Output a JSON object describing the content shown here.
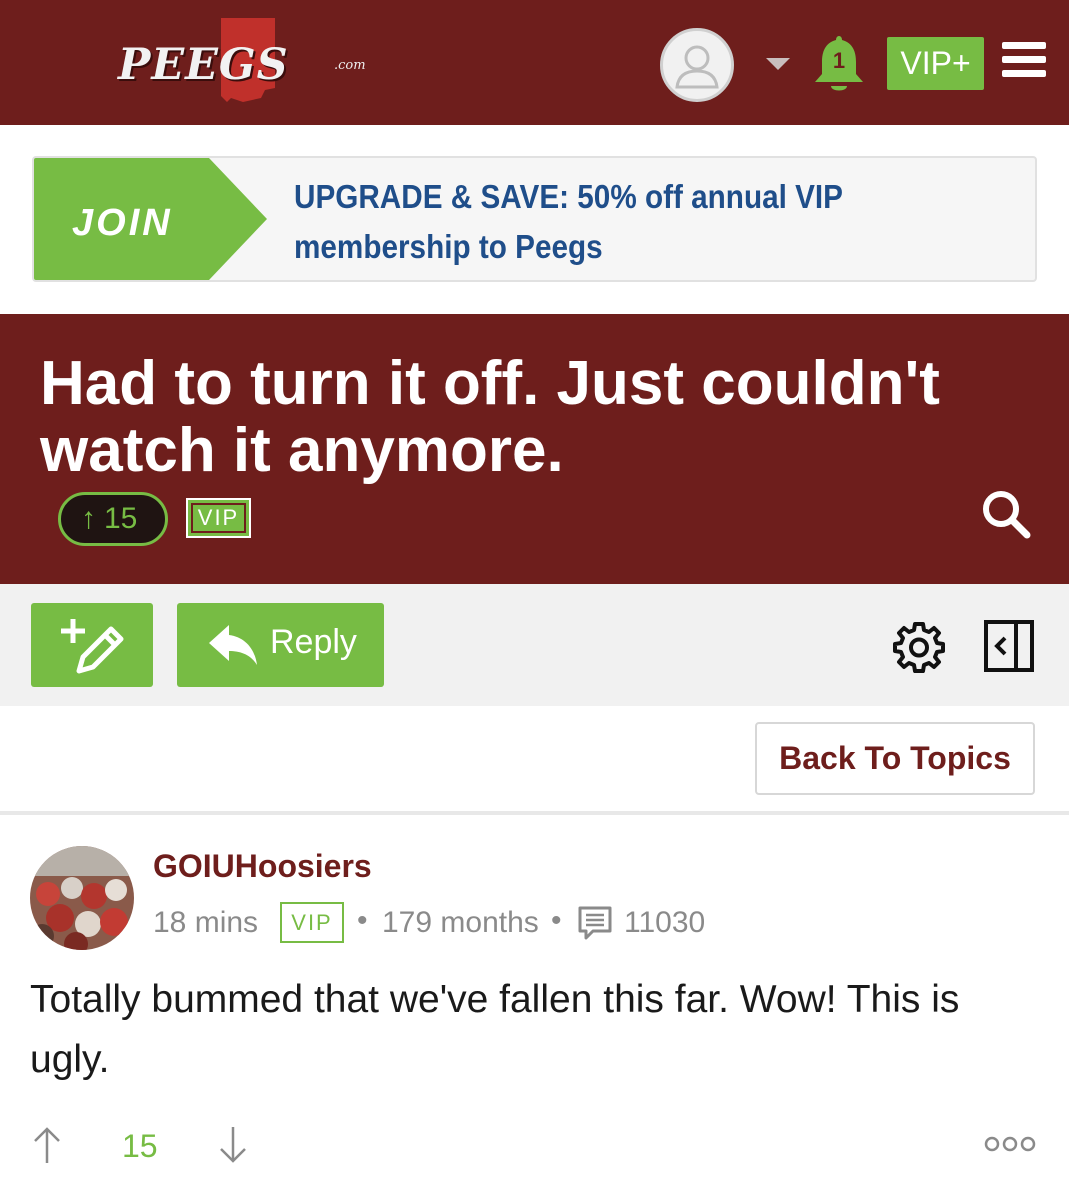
{
  "header": {
    "logo_text": "PEEGS",
    "logo_suffix": ".com",
    "notification_count": "1",
    "vip_plus_label": "VIP+",
    "icons": [
      "user-avatar-icon",
      "chevron-down-icon",
      "bell-icon",
      "hamburger-menu-icon"
    ],
    "colors": {
      "brand": "#6e1e1c",
      "accent": "#77bc44"
    }
  },
  "promo": {
    "join_label": "JOIN",
    "text": "UPGRADE & SAVE: 50% off annual VIP membership to Peegs"
  },
  "thread": {
    "title": "Had to turn it off. Just couldn't watch it anymore.",
    "vote_count": "15",
    "vip_badge": "VIP"
  },
  "toolbar": {
    "reply_label": "Reply",
    "icons": [
      "new-post-icon",
      "reply-arrow-icon",
      "gear-icon",
      "collapse-sidebar-icon",
      "search-icon"
    ]
  },
  "navigation": {
    "back_label": "Back To Topics"
  },
  "post": {
    "username": "GOIUHoosiers",
    "time": "18 mins",
    "vip_badge": "VIP",
    "separator": "•",
    "membership": "179 months",
    "post_count": "11030",
    "body": "Totally bummed that we've fallen this far. Wow! This is ugly.",
    "score": "15",
    "icons": [
      "upvote-arrow-icon",
      "downvote-arrow-icon",
      "more-options-icon",
      "posts-count-icon"
    ]
  }
}
